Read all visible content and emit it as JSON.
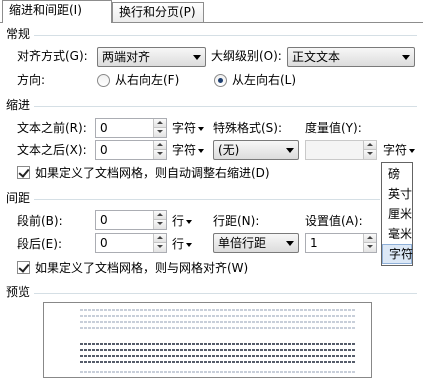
{
  "tabs": [
    {
      "label": "缩进和间距(I)",
      "active": true
    },
    {
      "label": "换行和分页(P)",
      "active": false
    }
  ],
  "general": {
    "title": "常规",
    "alignment_label": "对齐方式(G):",
    "alignment_value": "两端对齐",
    "outline_label": "大纲级别(O):",
    "outline_value": "正文文本",
    "direction_label": "方向:",
    "rtl_label": "从右向左(F)",
    "ltr_label": "从左向右(L)",
    "direction_selected": "ltr"
  },
  "indent": {
    "title": "缩进",
    "before_label": "文本之前(R):",
    "before_value": "0",
    "before_unit": "字符",
    "after_label": "文本之后(X):",
    "after_value": "0",
    "after_unit": "字符",
    "special_label": "特殊格式(S):",
    "special_value": "(无)",
    "measure_label": "度量值(Y):",
    "measure_value": "",
    "measure_unit": "字符",
    "grid_checkbox_label": "如果定义了文档网格，则自动调整右缩进(D)",
    "grid_checked": true
  },
  "unit_popup": {
    "items": [
      "磅",
      "英寸",
      "厘米",
      "毫米",
      "字符"
    ],
    "selected": "字符"
  },
  "spacing": {
    "title": "间距",
    "before_label": "段前(B):",
    "before_value": "0",
    "before_unit": "行",
    "after_label": "段后(E):",
    "after_value": "0",
    "after_unit": "行",
    "line_label": "行距(N):",
    "line_value": "单倍行距",
    "setting_label": "设置值(A):",
    "setting_value": "1",
    "grid_checkbox_label": "如果定义了文档网格，则与网格对齐(W)",
    "grid_checked": true
  },
  "preview": {
    "title": "预览"
  },
  "colors": {
    "section_line": "#d5dfe5",
    "popup_selected": "#dce8f6"
  }
}
